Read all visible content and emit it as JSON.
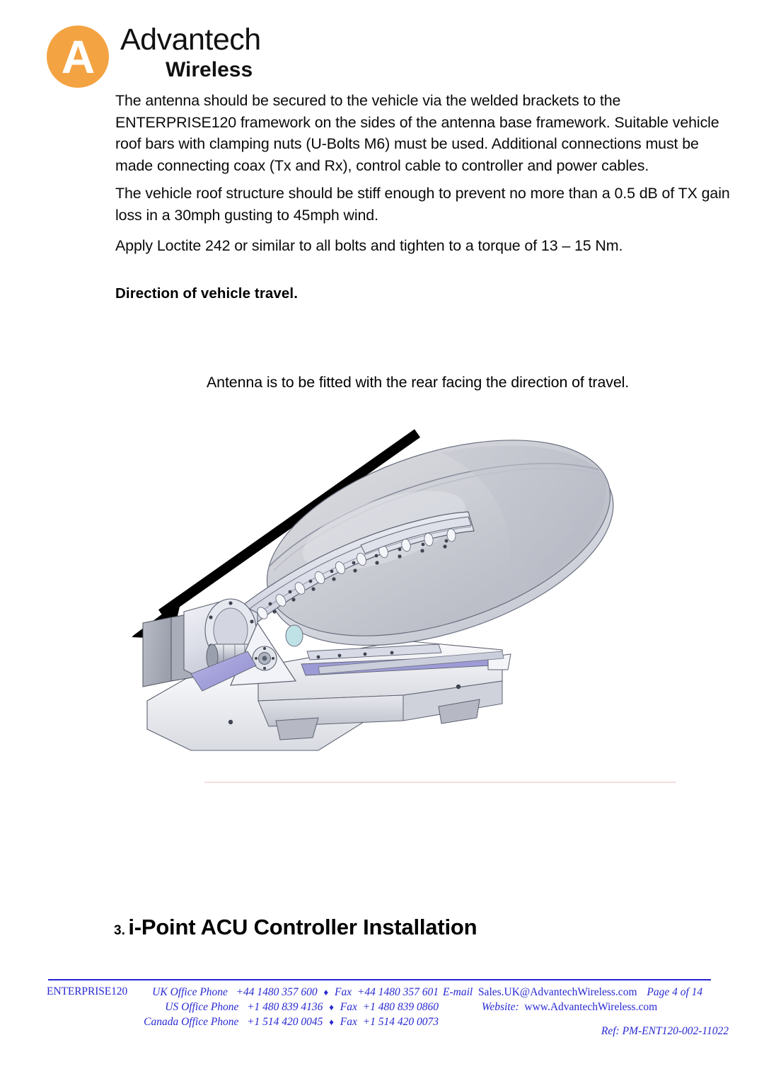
{
  "brand": {
    "logo_letter": "A",
    "name": "Advantech",
    "tagline": "Wireless",
    "logo_color": "#f4a342"
  },
  "body": {
    "paragraph_1": "The antenna should be secured to the vehicle via the welded brackets to the ENTERPRISE120 framework on the sides of the antenna base framework. Suitable vehicle roof bars with clamping nuts (U-Bolts M6) must be used. Additional connections must be made connecting coax (Tx and Rx), control cable to controller and power cables.",
    "paragraph_2": "The vehicle roof structure should be stiff enough to prevent no more than a 0.5 dB of TX gain loss in a 30mph gusting to 45mph wind.",
    "paragraph_3": "Apply Loctite 242 or similar to all bolts and tighten to a torque of 13 – 15 Nm.",
    "travel_heading": "Direction of vehicle travel.",
    "fitted_note": "Antenna is to be fitted with the rear facing the direction of travel."
  },
  "figure": {
    "caption": "",
    "arrow_label": "direction-of-travel-arrow",
    "illustration_name": "enterprise120-vehicle-mount-antenna-cad-view"
  },
  "section": {
    "number": "3.",
    "title": "i-Point ACU Controller Installation"
  },
  "footer": {
    "doc_id": "ENTERPRISE120",
    "rule_color": "#2323d8",
    "text_color": "#2828d2",
    "separator": "♦",
    "contacts": [
      {
        "office": "UK Office Phone",
        "phone": "+44 1480 357 600",
        "fax_label": "Fax",
        "fax": "+44 1480 357 601"
      },
      {
        "office": "US Office Phone",
        "phone": "+1 480 839 4136",
        "fax_label": "Fax",
        "fax": "+1 480 839 0860"
      },
      {
        "office": "Canada Office Phone",
        "phone": "+1 514 420 0045",
        "fax_label": "Fax",
        "fax": "+1 514 420 0073"
      }
    ],
    "email_label": "E-mail",
    "email": "Sales.UK@AdvantechWireless.com",
    "page_text": "Page  4  of  14",
    "website_label": "Website:",
    "website": "www.AdvantechWireless.com",
    "ref": "Ref: PM-ENT120-002-11022"
  }
}
